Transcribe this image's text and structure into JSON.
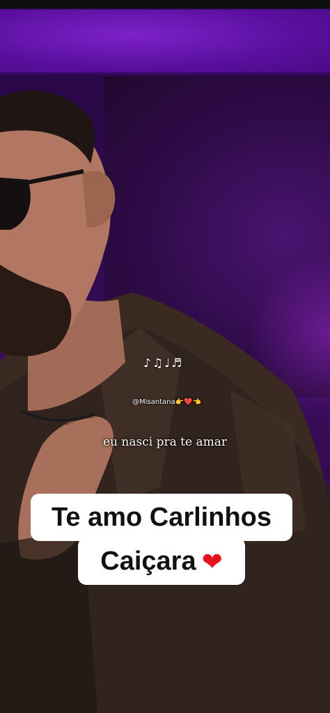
{
  "overlay": {
    "music_notes": "♪♫♩♬",
    "handle": "@Misantana👉❤️👈",
    "lyric": "eu nasci pra te amar",
    "caption_line1": "Te amo Carlinhos",
    "caption_line2": "Caiçara",
    "heart": "❤"
  },
  "colors": {
    "stage_purple": "#6a12b3",
    "caption_bg": "#ffffff",
    "heart": "#e8121e"
  }
}
